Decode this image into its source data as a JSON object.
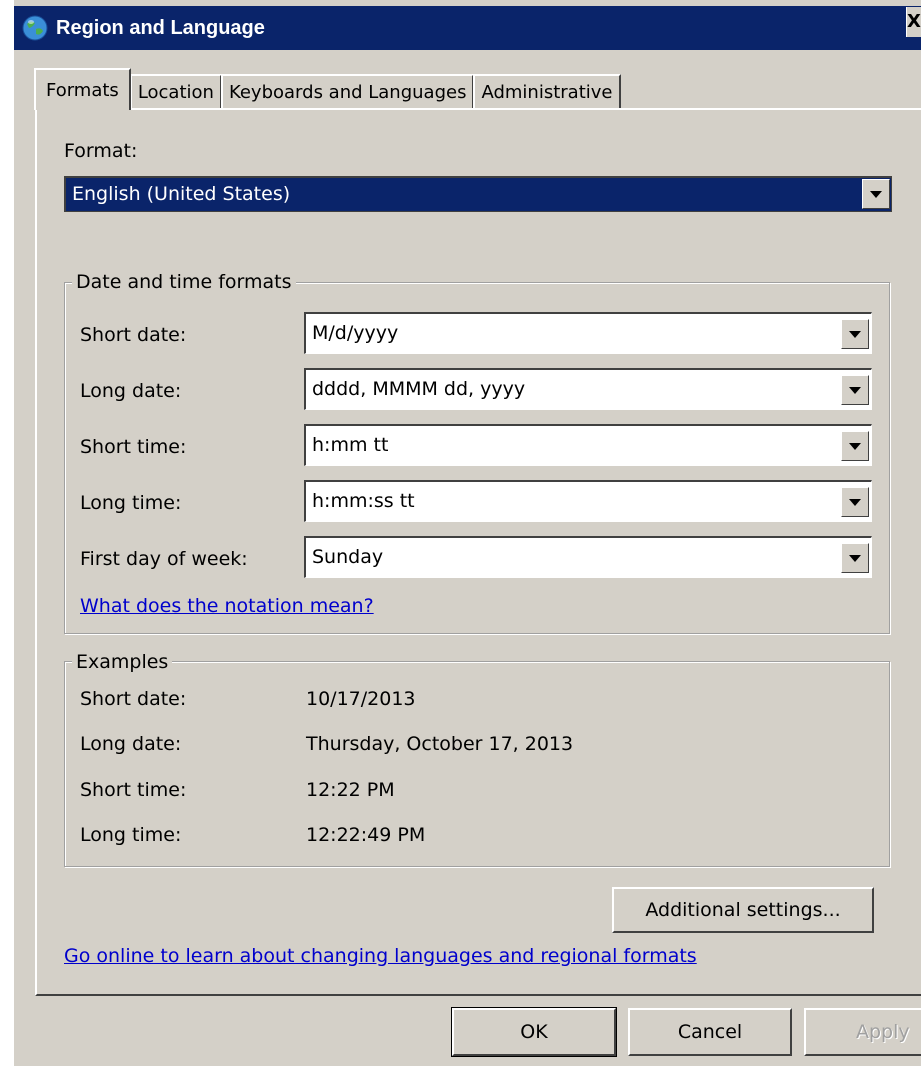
{
  "window": {
    "title": "Region and Language",
    "close_glyph": "X"
  },
  "tabs": [
    {
      "label": "Formats",
      "active": true
    },
    {
      "label": "Location",
      "active": false
    },
    {
      "label": "Keyboards and Languages",
      "active": false
    },
    {
      "label": "Administrative",
      "active": false
    }
  ],
  "format": {
    "label": "Format:",
    "value": "English (United States)"
  },
  "date_time_formats": {
    "title": "Date and time formats",
    "rows": [
      {
        "label": "Short date:",
        "value": "M/d/yyyy"
      },
      {
        "label": "Long date:",
        "value": "dddd, MMMM dd, yyyy"
      },
      {
        "label": "Short time:",
        "value": "h:mm tt"
      },
      {
        "label": "Long time:",
        "value": "h:mm:ss tt"
      },
      {
        "label": "First day of week:",
        "value": "Sunday"
      }
    ],
    "notation_link": "What does the notation mean?"
  },
  "examples": {
    "title": "Examples",
    "rows": [
      {
        "label": "Short date:",
        "value": "10/17/2013"
      },
      {
        "label": "Long date:",
        "value": "Thursday, October 17, 2013"
      },
      {
        "label": "Short time:",
        "value": "12:22 PM"
      },
      {
        "label": "Long time:",
        "value": "12:22:49 PM"
      }
    ]
  },
  "additional_settings_label": "Additional settings...",
  "online_link": "Go online to learn about changing languages and regional formats",
  "footer": {
    "ok_label": "OK",
    "cancel_label": "Cancel",
    "apply_label": "Apply"
  },
  "colors": {
    "titlebar": "#0a246a",
    "face": "#d4d0c8",
    "link": "#0000cc"
  },
  "icons": {
    "title_icon": "globe-icon",
    "dropdown": "chevron-down-icon"
  }
}
